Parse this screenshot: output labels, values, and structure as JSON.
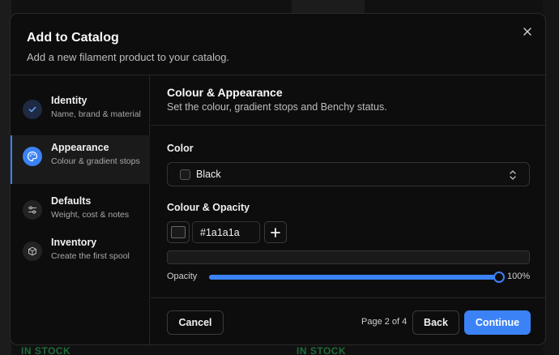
{
  "dialog": {
    "title": "Add to Catalog",
    "subtitle": "Add a new filament product to your catalog.",
    "close_icon": "close-icon"
  },
  "steps": [
    {
      "title": "Identity",
      "description": "Name, brand & material",
      "icon": "check-icon",
      "state": "complete"
    },
    {
      "title": "Appearance",
      "description": "Colour & gradient stops",
      "icon": "palette-icon",
      "state": "current"
    },
    {
      "title": "Defaults",
      "description": "Weight, cost & notes",
      "icon": "sliders-icon",
      "state": "pending"
    },
    {
      "title": "Inventory",
      "description": "Create the first spool",
      "icon": "box-icon",
      "state": "pending"
    }
  ],
  "section": {
    "title": "Colour & Appearance",
    "description": "Set the colour, gradient stops and Benchy status."
  },
  "color_field": {
    "label": "Color",
    "selected": "Black",
    "swatch": "#1a1a1a"
  },
  "colour_opacity": {
    "label": "Colour & Opacity",
    "hex_value": "#1a1a1a",
    "opacity_label": "Opacity",
    "opacity_value": 100,
    "opacity_text": "100%"
  },
  "footer": {
    "cancel_label": "Cancel",
    "page_indicator": "Page 2 of 4",
    "back_label": "Back",
    "continue_label": "Continue"
  },
  "background": {
    "stock_badges": [
      "IN STOCK",
      "IN STOCK"
    ]
  },
  "colors": {
    "accent": "#3b82f6",
    "surface": "#0d0d0d",
    "border": "#262626"
  }
}
